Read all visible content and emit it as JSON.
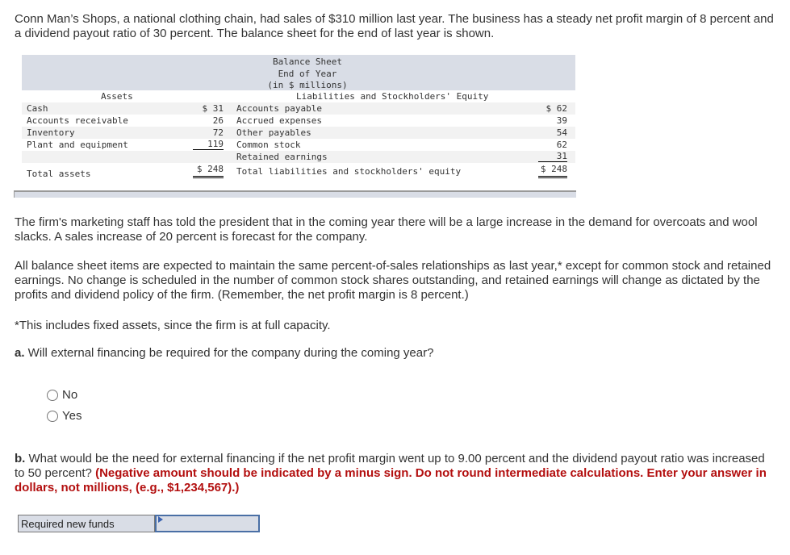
{
  "intro": "Conn Man’s Shops, a national clothing chain, had sales of $310 million last year. The business has a steady net profit margin of 8 percent and a dividend payout ratio of 30 percent. The balance sheet for the end of last year is shown.",
  "balance_sheet": {
    "title_lines": [
      "Balance Sheet",
      "End of Year",
      "(in $ millions)"
    ],
    "assets_header": "Assets",
    "liabilities_header": "Liabilities and Stockholders' Equity",
    "rows": [
      {
        "asset": "Cash",
        "asset_value": "$ 31",
        "liability": "Accounts payable",
        "liability_value": "$ 62"
      },
      {
        "asset": "Accounts receivable",
        "asset_value": "26",
        "liability": "Accrued expenses",
        "liability_value": "39"
      },
      {
        "asset": "Inventory",
        "asset_value": "72",
        "liability": "Other payables",
        "liability_value": "54"
      },
      {
        "asset": "Plant and equipment",
        "asset_value": "119",
        "liability": "Common stock",
        "liability_value": "62"
      },
      {
        "asset": "",
        "asset_value": "",
        "liability": "Retained earnings",
        "liability_value": "31"
      }
    ],
    "total_assets_label": "Total assets",
    "total_assets_value": "$ 248",
    "total_liabilities_label": "Total liabilities and stockholders' equity",
    "total_liabilities_value": "$ 248"
  },
  "marketing": "The firm's marketing staff has told the president that in the coming year there will be a large increase in the demand for overcoats and wool slacks. A sales increase of 20 percent is forecast for the company.",
  "percent_of_sales": "All balance sheet items are expected to maintain the same percent-of-sales relationships as last year,* except for common stock and retained earnings. No change is scheduled in the number of common stock shares outstanding, and retained earnings will change as dictated by the profits and dividend policy of the firm. (Remember, the net profit margin is 8 percent.)",
  "footnote": "*This includes fixed assets, since the firm is at full capacity.",
  "question_a": {
    "prefix": "a.",
    "text": " Will external financing be required for the company during the coming year?",
    "options": [
      "No",
      "Yes"
    ]
  },
  "question_b": {
    "prefix": "b.",
    "text": " What would be the need for external financing if the net profit margin went up to 9.00 percent and the dividend payout ratio was increased to 50 percent? ",
    "instruction": "(Negative amount should be indicated by a minus sign. Do not round intermediate calculations. Enter your answer in dollars, not millions, (e.g., $1,234,567).)",
    "answer_label": "Required new funds",
    "answer_value": ""
  }
}
